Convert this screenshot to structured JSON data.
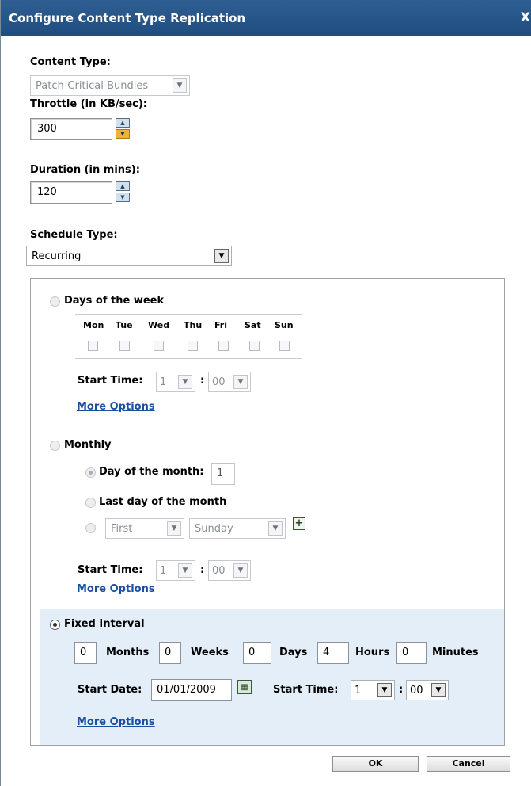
{
  "window": {
    "title": "Configure Content Type Replication",
    "close_glyph": "X"
  },
  "content_type": {
    "label": "Content Type:",
    "value": "Patch-Critical-Bundles"
  },
  "throttle": {
    "label": "Throttle (in KB/sec):",
    "value": "300"
  },
  "duration": {
    "label": "Duration (in mins):",
    "value": "120"
  },
  "schedule_type": {
    "label": "Schedule Type:",
    "value": "Recurring"
  },
  "days_of_week": {
    "label": "Days of the week",
    "days": [
      "Mon",
      "Tue",
      "Wed",
      "Thu",
      "Fri",
      "Sat",
      "Sun"
    ],
    "start_time_label": "Start Time:",
    "hour": "1",
    "separator": ":",
    "minute": "00",
    "more_options": "More Options"
  },
  "monthly": {
    "label": "Monthly",
    "day_of_month_label": "Day of the month:",
    "day_of_month_value": "1",
    "last_day_label": "Last day of the month",
    "ordinal": "First",
    "weekday": "Sunday",
    "start_time_label": "Start Time:",
    "hour": "1",
    "separator": ":",
    "minute": "00",
    "more_options": "More Options"
  },
  "fixed_interval": {
    "label": "Fixed Interval",
    "months_value": "0",
    "months_label": "Months",
    "weeks_value": "0",
    "weeks_label": "Weeks",
    "days_value": "0",
    "days_label": "Days",
    "hours_value": "4",
    "hours_label": "Hours",
    "minutes_value": "0",
    "minutes_label": "Minutes",
    "start_date_label": "Start Date:",
    "start_date_value": "01/01/2009",
    "start_time_label": "Start Time:",
    "hour": "1",
    "separator": ":",
    "minute": "00",
    "more_options": "More Options"
  },
  "buttons": {
    "ok": "OK",
    "cancel": "Cancel"
  },
  "colors": {
    "titlebar": "#1f4d80",
    "fixed_interval_background": "#e3eef9",
    "link": "#1a4fa0"
  }
}
